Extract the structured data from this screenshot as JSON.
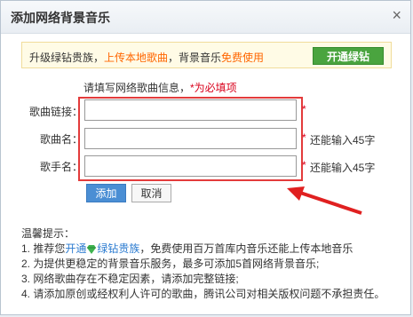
{
  "dialog": {
    "title": "添加网络背景音乐",
    "close": "×"
  },
  "banner": {
    "text_a": "升级绿钻贵族，",
    "text_b": "上传本地歌曲",
    "text_c": "，背景音乐",
    "text_d": "免费使用",
    "button": "开通绿钻"
  },
  "form": {
    "hint": "请填写网络歌曲信息，",
    "hint_required": "*为必填项",
    "link_label": "歌曲链接：",
    "link_value": "",
    "name_label": "歌曲名：",
    "name_value": "",
    "name_limit": "还能输入45字",
    "singer_label": "歌手名：",
    "singer_value": "",
    "singer_limit": "还能输入45字",
    "asterisk": "*"
  },
  "buttons": {
    "add": "添加",
    "cancel": "取消"
  },
  "tips": {
    "title": "温馨提示：",
    "line1_a": "1. 推荐您",
    "line1_link1": "开通",
    "line1_link2": "绿钻贵族",
    "line1_b": "，免费使用百万首库内音乐还能上传本地音乐",
    "line2": "2. 为提供更稳定的背景音乐服务，最多可添加5首网络背景音乐;",
    "line3": "3. 网络歌曲存在不稳定因素，请添加完整链接;",
    "line4": "4. 请添加原创或经权利人许可的歌曲，腾讯公司对相关版权问题不承担责任。"
  },
  "colors": {
    "accent_red": "#e33b3b",
    "green": "#4aa43f",
    "link_blue": "#2b7bd0",
    "orange": "#ff6600"
  },
  "icons": {
    "close": "close-icon",
    "gem": "green-diamond-icon",
    "arrow": "red-arrow-annotation"
  }
}
